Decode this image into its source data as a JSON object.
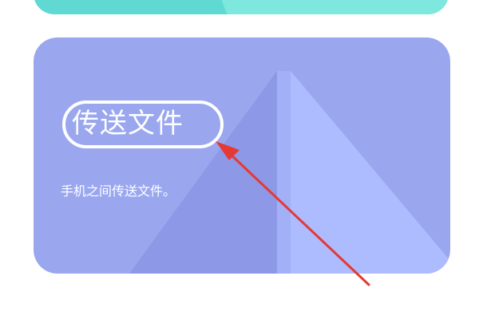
{
  "card": {
    "title": "传送文件",
    "description": "手机之间传送文件。"
  },
  "colors": {
    "top_card": "#5fd9d2",
    "main_card": "#9aa7ef",
    "annotation_arrow": "#e53935",
    "title_text": "#ffffff"
  }
}
